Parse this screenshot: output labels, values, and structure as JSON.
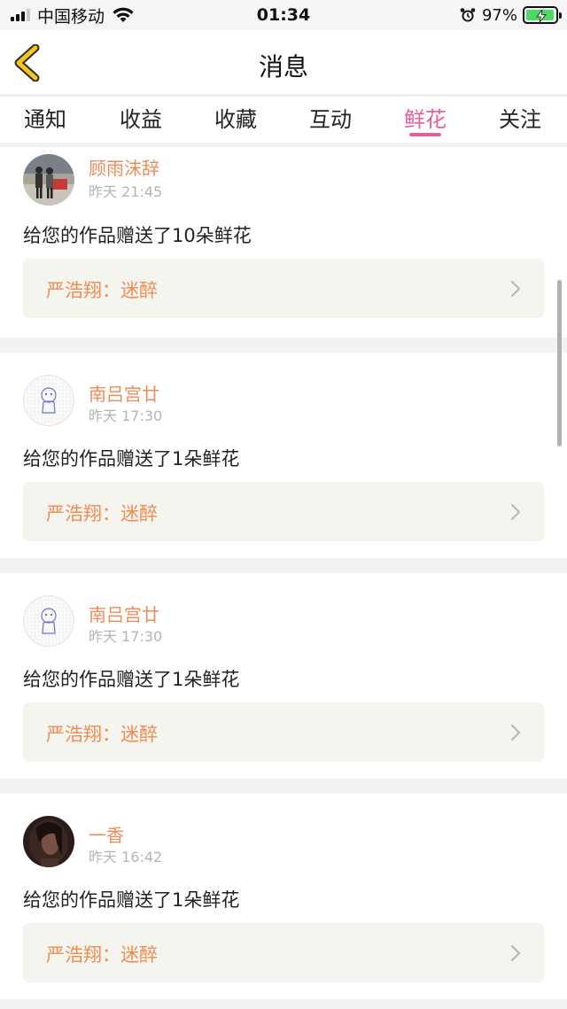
{
  "status_bar": {
    "carrier": "中国移动",
    "time": "01:34",
    "battery_percent": "97%",
    "battery_level": 0.97,
    "accent_battery": "#4cd964"
  },
  "nav": {
    "title": "消息",
    "back_icon": "back-chevron-icon",
    "accent": "#f3c51e"
  },
  "tabs": [
    {
      "label": "通知"
    },
    {
      "label": "收益"
    },
    {
      "label": "收藏"
    },
    {
      "label": "互动"
    },
    {
      "label": "鲜花",
      "active": true
    },
    {
      "label": "关注"
    }
  ],
  "tab_active_color": "#e5609a",
  "messages": [
    {
      "username": "顾雨沫辞",
      "time": "昨天 21:45",
      "text": "给您的作品赠送了10朵鲜花",
      "work": "严浩翔：迷醉",
      "avatar": "photo-avatar-street"
    },
    {
      "username": "南吕宫廿",
      "time": "昨天 17:30",
      "text": "给您的作品赠送了1朵鲜花",
      "work": "严浩翔：迷醉",
      "avatar": "sketch-avatar"
    },
    {
      "username": "南吕宫廿",
      "time": "昨天 17:30",
      "text": "给您的作品赠送了1朵鲜花",
      "work": "严浩翔：迷醉",
      "avatar": "sketch-avatar"
    },
    {
      "username": "一香",
      "time": "昨天 16:42",
      "text": "给您的作品赠送了1朵鲜花",
      "work": "严浩翔：迷醉",
      "avatar": "photo-avatar-portrait"
    }
  ],
  "colors": {
    "username": "#ee8b5a",
    "work_title": "#f08b52",
    "work_box_bg": "#f5f5ef"
  }
}
